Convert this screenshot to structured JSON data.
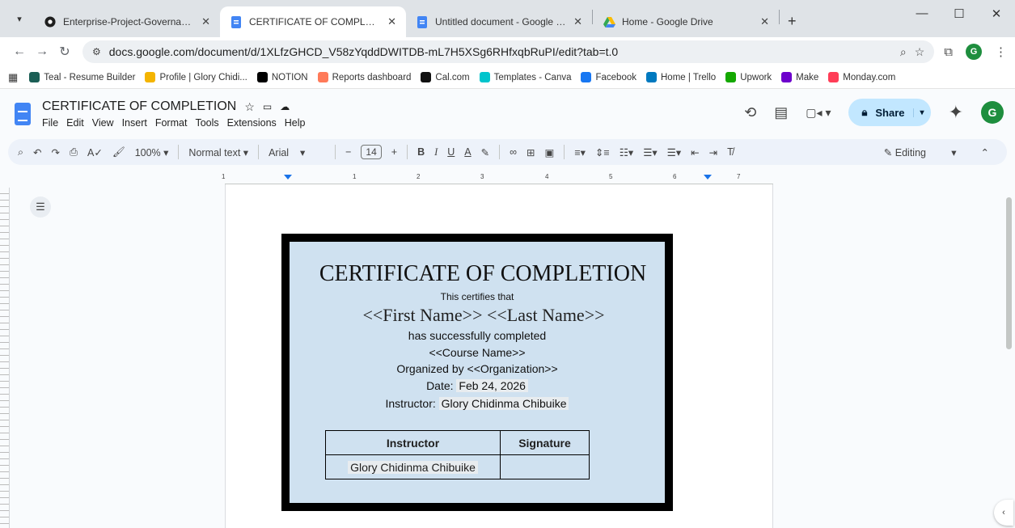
{
  "browser": {
    "tabs": [
      {
        "title": "Enterprise-Project-Governance",
        "icon": "github-icon"
      },
      {
        "title": "CERTIFICATE OF COMPLETION",
        "icon": "google-docs-icon"
      },
      {
        "title": "Untitled document - Google Do",
        "icon": "google-docs-icon"
      },
      {
        "title": "Home - Google Drive",
        "icon": "google-drive-icon"
      }
    ],
    "new_tab": "+",
    "url": "docs.google.com/document/d/1XLfzGHCD_V58zYqddDWITDB-mL7H5XSg6RHfxqbRuPI/edit?tab=t.0",
    "profile_initial": "G",
    "bookmarks": [
      {
        "label": "Teal - Resume Builder",
        "color": "#1b5e55"
      },
      {
        "label": "Profile | Glory Chidi...",
        "color": "#f4b400"
      },
      {
        "label": "NOTION",
        "color": "#000000"
      },
      {
        "label": "Reports dashboard",
        "color": "#ff7a59"
      },
      {
        "label": "Cal.com",
        "color": "#111111"
      },
      {
        "label": "Templates - Canva",
        "color": "#00c4cc"
      },
      {
        "label": "Facebook",
        "color": "#1877f2"
      },
      {
        "label": "Home | Trello",
        "color": "#0079bf"
      },
      {
        "label": "Upwork",
        "color": "#14a800"
      },
      {
        "label": "Make",
        "color": "#6d00cc"
      },
      {
        "label": "Monday.com",
        "color": "#ff3d57"
      }
    ]
  },
  "docs": {
    "title": "CERTIFICATE OF COMPLETION",
    "menus": [
      "File",
      "Edit",
      "View",
      "Insert",
      "Format",
      "Tools",
      "Extensions",
      "Help"
    ],
    "share_label": "Share",
    "user_initial": "G",
    "toolbar": {
      "zoom": "100%",
      "style": "Normal text",
      "font": "Arial",
      "font_size": "14",
      "mode": "Editing"
    },
    "ruler_numbers": [
      "1",
      "1",
      "2",
      "3",
      "4",
      "5",
      "6",
      "7"
    ]
  },
  "certificate": {
    "title": "CERTIFICATE OF COMPLETION",
    "certifies": "This certifies that",
    "name": "<<First Name>> <<Last Name>>",
    "completed": "has successfully completed",
    "course": "<<Course Name>>",
    "organized": "Organized by <<Organization>>",
    "date_label": "Date:",
    "date_value": "Feb 24, 2026",
    "instructor_label": "Instructor:",
    "instructor_value": "Glory Chidinma Chibuike",
    "table": {
      "headers": [
        "Instructor",
        "Signature"
      ],
      "row": [
        "Glory Chidinma Chibuike",
        ""
      ]
    }
  }
}
